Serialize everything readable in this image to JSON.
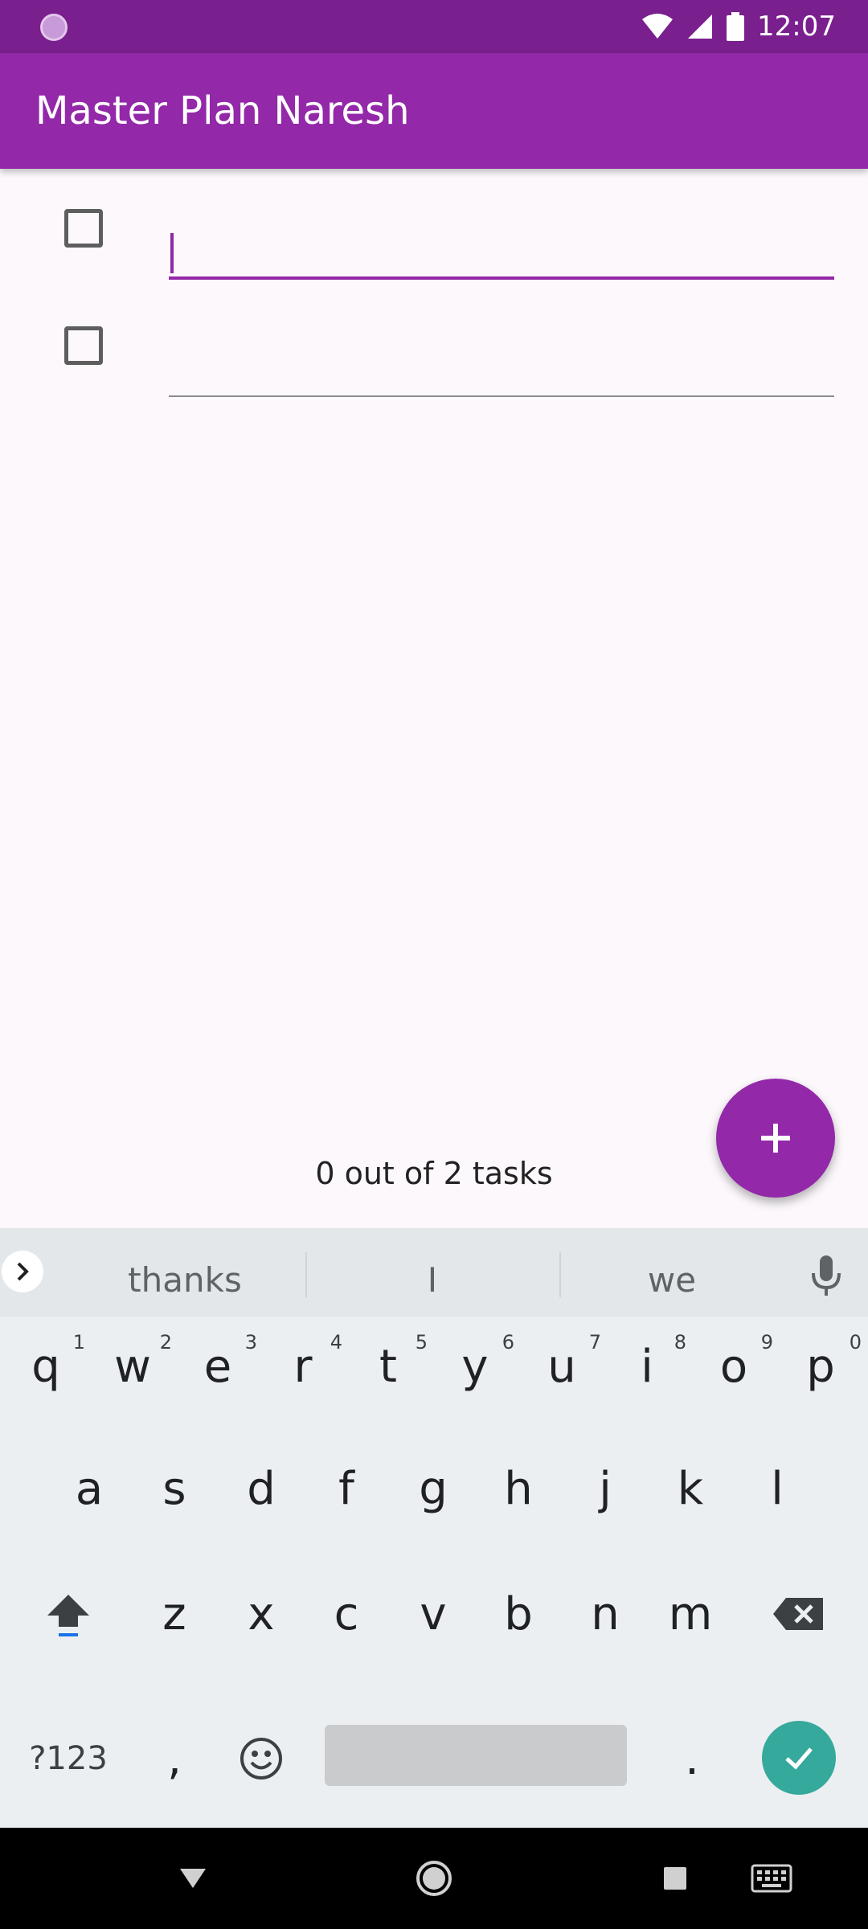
{
  "status_bar": {
    "time": "12:07"
  },
  "app_bar": {
    "title": "Master Plan Naresh"
  },
  "tasks": [
    {
      "value": "",
      "checked": false
    },
    {
      "value": "",
      "checked": false
    }
  ],
  "summary": "0 out of 2 tasks",
  "keyboard": {
    "suggestions": [
      "thanks",
      "I",
      "we"
    ],
    "row1": [
      {
        "k": "q",
        "h": "1"
      },
      {
        "k": "w",
        "h": "2"
      },
      {
        "k": "e",
        "h": "3"
      },
      {
        "k": "r",
        "h": "4"
      },
      {
        "k": "t",
        "h": "5"
      },
      {
        "k": "y",
        "h": "6"
      },
      {
        "k": "u",
        "h": "7"
      },
      {
        "k": "i",
        "h": "8"
      },
      {
        "k": "o",
        "h": "9"
      },
      {
        "k": "p",
        "h": "0"
      }
    ],
    "row2": [
      "a",
      "s",
      "d",
      "f",
      "g",
      "h",
      "j",
      "k",
      "l"
    ],
    "row3": [
      "z",
      "x",
      "c",
      "v",
      "b",
      "n",
      "m"
    ],
    "symbols_label": "?123",
    "comma": ",",
    "period": "."
  },
  "colors": {
    "primary": "#9328a9",
    "status_bar": "#7a1f8e",
    "accent_enter": "#35a99b"
  }
}
